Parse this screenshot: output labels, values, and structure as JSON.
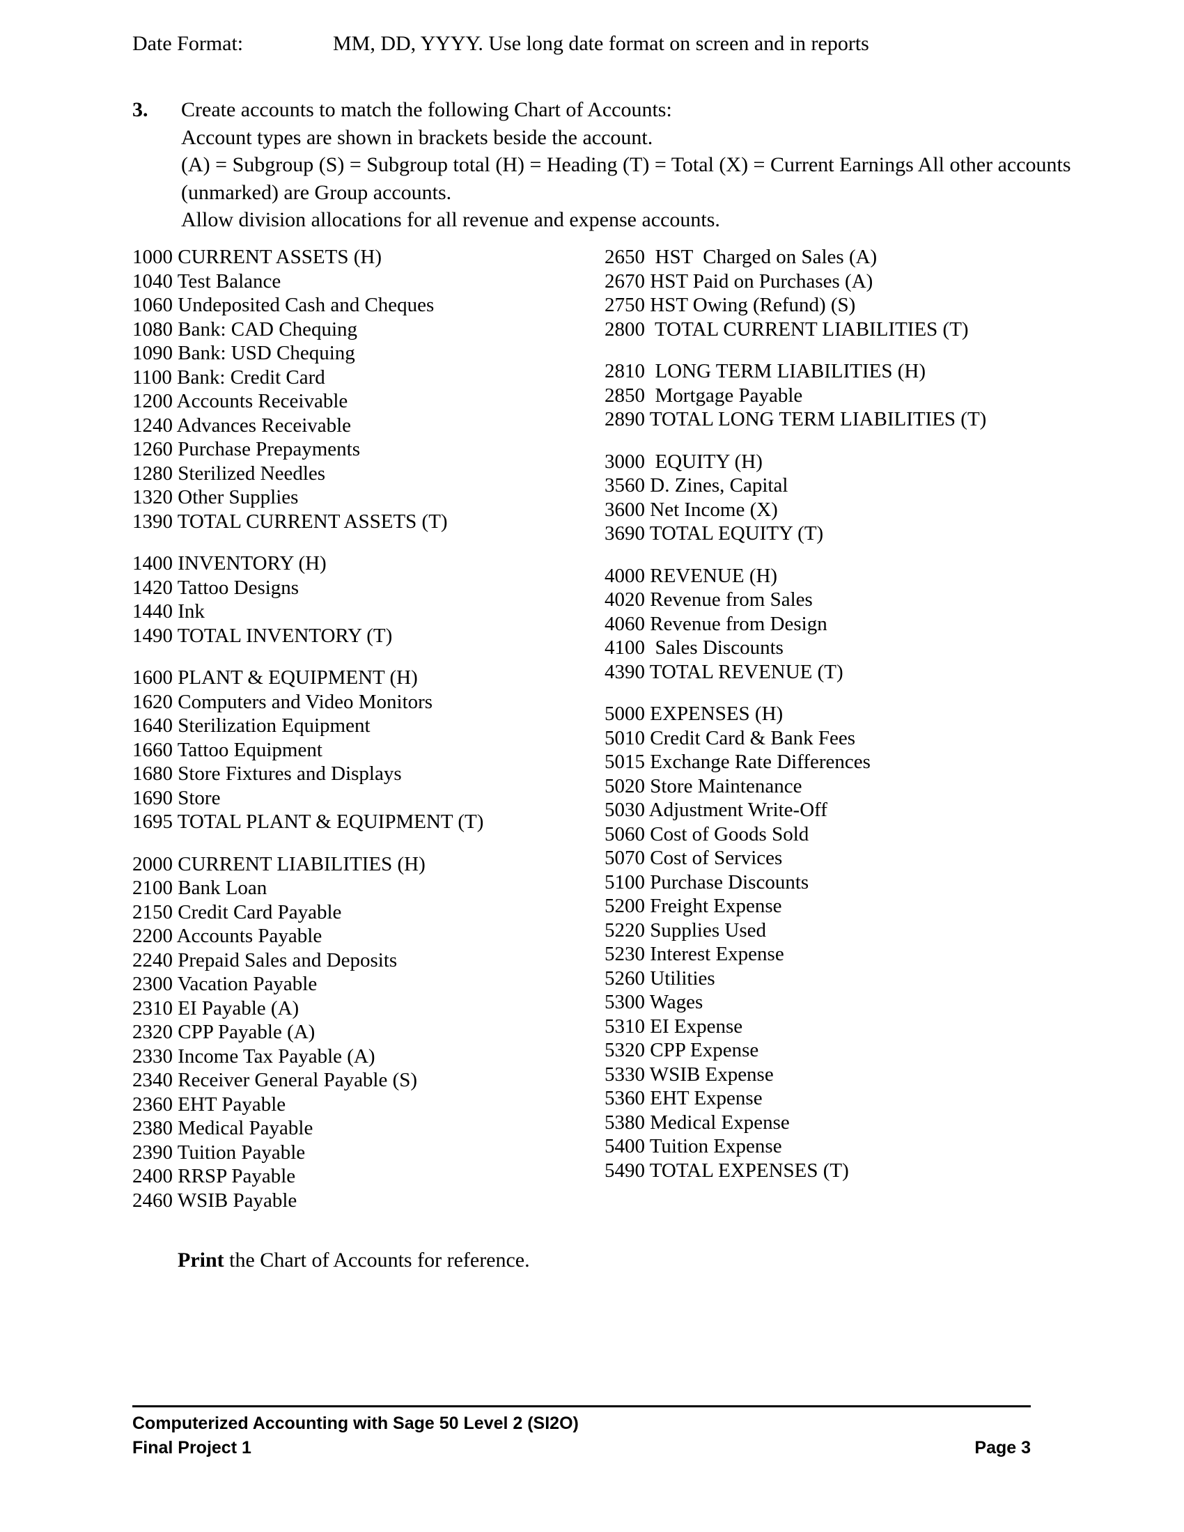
{
  "intro": {
    "date_format_label": "Date Format:",
    "date_format_value": "MM, DD, YYYY. Use long date format on screen and in reports"
  },
  "item": {
    "number": "3.",
    "lines": [
      "Create accounts to match the following Chart of Accounts:",
      "Account types are shown in brackets beside the account.",
      "(A) = Subgroup  (S) = Subgroup total  (H) = Heading  (T) = Total  (X) = Current Earnings All other accounts (unmarked) are Group accounts.",
      "Allow division allocations for all revenue and expense accounts."
    ]
  },
  "chart_of_accounts": {
    "left_column": [
      {
        "group": "current-assets",
        "lines": [
          "1000 CURRENT ASSETS (H)",
          "1040 Test Balance",
          "1060 Undeposited Cash and Cheques",
          "1080 Bank: CAD Chequing",
          "1090 Bank: USD Chequing",
          "1100 Bank: Credit Card",
          "1200 Accounts Receivable",
          "1240 Advances Receivable",
          "1260 Purchase Prepayments",
          "1280 Sterilized Needles",
          "1320 Other Supplies",
          "1390 TOTAL CURRENT ASSETS (T)"
        ]
      },
      {
        "group": "inventory",
        "lines": [
          "1400 INVENTORY (H)",
          "1420 Tattoo Designs",
          "1440 Ink",
          "1490 TOTAL INVENTORY (T)"
        ]
      },
      {
        "group": "plant-and-equipment",
        "lines": [
          "1600 PLANT & EQUIPMENT (H)",
          "1620 Computers and Video Monitors",
          "1640 Sterilization Equipment",
          "1660 Tattoo Equipment",
          "1680 Store Fixtures and Displays",
          "1690 Store",
          "1695 TOTAL PLANT & EQUIPMENT (T)"
        ]
      },
      {
        "group": "current-liabilities",
        "lines": [
          "2000 CURRENT LIABILITIES (H)",
          "2100 Bank Loan",
          "2150 Credit Card Payable",
          "2200 Accounts Payable",
          "2240 Prepaid Sales and Deposits",
          "2300 Vacation Payable",
          "2310 EI Payable (A)",
          "2320 CPP Payable (A)",
          "2330 Income Tax Payable (A)",
          "2340 Receiver General Payable (S)",
          "2360 EHT Payable",
          "2380 Medical Payable",
          "2390 Tuition Payable",
          "2400 RRSP Payable",
          "2460 WSIB Payable"
        ]
      }
    ],
    "right_column": [
      {
        "group": "hst-and-total-current-liabilities",
        "lines": [
          "2650  HST  Charged on Sales (A)",
          "2670 HST Paid on Purchases (A)",
          "2750 HST Owing (Refund) (S)",
          "2800  TOTAL CURRENT LIABILITIES (T)"
        ]
      },
      {
        "group": "long-term-liabilities",
        "lines": [
          "2810  LONG TERM LIABILITIES (H)",
          "2850  Mortgage Payable",
          "2890 TOTAL LONG TERM LIABILITIES (T)"
        ]
      },
      {
        "group": "equity",
        "lines": [
          "3000  EQUITY (H)",
          "3560 D. Zines, Capital",
          "3600 Net Income (X)",
          "3690 TOTAL EQUITY (T)"
        ]
      },
      {
        "group": "revenue",
        "lines": [
          "4000 REVENUE (H)",
          "4020 Revenue from Sales",
          "4060 Revenue from Design",
          "4100  Sales Discounts",
          "4390 TOTAL REVENUE (T)"
        ]
      },
      {
        "group": "expenses",
        "lines": [
          "5000 EXPENSES (H)",
          "5010 Credit Card & Bank Fees",
          "5015 Exchange Rate Differences",
          "5020 Store Maintenance",
          "5030 Adjustment Write-Off",
          "5060 Cost of Goods Sold",
          "5070 Cost of Services",
          "5100 Purchase Discounts",
          "5200 Freight Expense",
          "5220 Supplies Used",
          "5230 Interest Expense",
          "5260 Utilities",
          "5300 Wages",
          "5310 EI Expense",
          "5320 CPP Expense",
          "5330 WSIB Expense",
          "5360 EHT Expense",
          "5380 Medical Expense",
          "5400 Tuition Expense",
          "5490 TOTAL EXPENSES (T)"
        ]
      }
    ]
  },
  "print_instruction": {
    "bold": "Print",
    "rest": " the Chart of Accounts for reference."
  },
  "footer": {
    "line1": "Computerized Accounting with Sage 50 Level 2 (SI2O)",
    "line2_left": "Final Project 1",
    "line2_right": "Page 3"
  }
}
